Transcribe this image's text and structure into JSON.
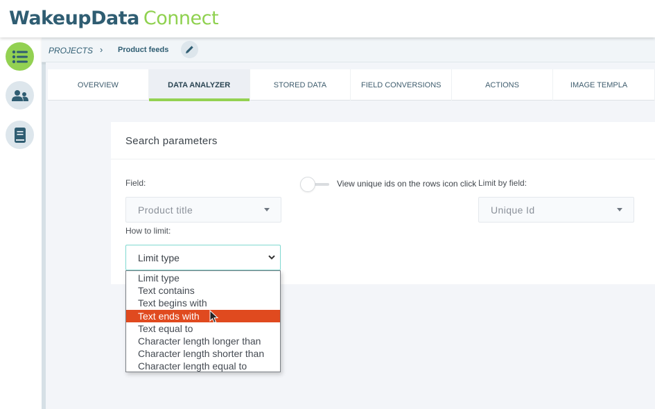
{
  "app": {
    "brand_part1": "WakeupData",
    "brand_part2": "Connect",
    "colors": {
      "brand_dark": "#2f5d72",
      "brand_green": "#8fd14f",
      "highlight": "#e04a1f",
      "focus": "#7fd8d0"
    }
  },
  "sidebar": {
    "items": [
      {
        "icon": "list-icon",
        "active": true
      },
      {
        "icon": "users-icon",
        "active": false
      },
      {
        "icon": "book-icon",
        "active": false
      }
    ]
  },
  "breadcrumb": {
    "root": "PROJECTS",
    "separator": "›",
    "current": "Product feeds"
  },
  "tabs": [
    {
      "label": "OVERVIEW",
      "active": false
    },
    {
      "label": "DATA ANALYZER",
      "active": true
    },
    {
      "label": "STORED DATA",
      "active": false
    },
    {
      "label": "FIELD CONVERSIONS",
      "active": false
    },
    {
      "label": "ACTIONS",
      "active": false
    },
    {
      "label": "IMAGE TEMPLA",
      "active": false
    }
  ],
  "search": {
    "title": "Search parameters",
    "field_label": "Field:",
    "field_value": "Product title",
    "toggle_label": "View unique ids on the rows icon click",
    "toggle_on": false,
    "limit_by_label": "Limit by field:",
    "limit_by_value": "Unique Id",
    "how_label": "How to limit:",
    "how_value": "Limit type",
    "how_options": [
      "Limit type",
      "Text contains",
      "Text begins with",
      "Text ends with",
      "Text equal to",
      "Character length longer than",
      "Character length shorter than",
      "Character length equal to"
    ],
    "highlighted_option": "Text ends with"
  }
}
